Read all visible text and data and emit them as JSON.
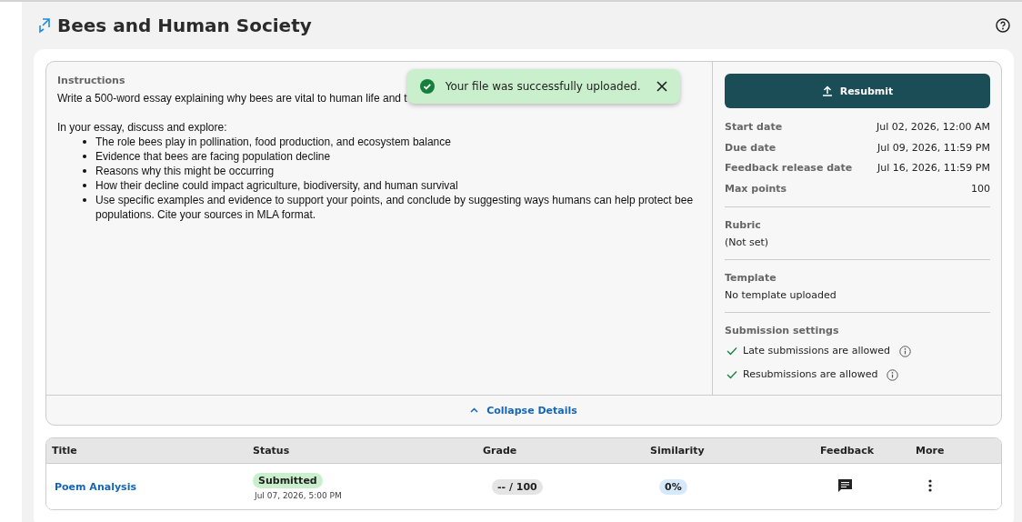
{
  "page": {
    "title": "Bees and Human Society"
  },
  "toast": {
    "message": "Your file was successfully uploaded."
  },
  "instructions": {
    "label": "Instructions",
    "intro": "Write a 500-word essay explaining why bees are vital to human life and t",
    "lead": "In your essay, discuss and explore:",
    "bullets": [
      "The role bees play in pollination, food production, and ecosystem balance",
      "Evidence that bees are facing population decline",
      "Reasons why this might be occurring",
      "How their decline could impact agriculture, biodiversity, and human survival",
      "Use specific examples and evidence to support your points, and conclude by suggesting ways humans can help protect bee populations. Cite your sources in MLA format."
    ]
  },
  "details": {
    "button": "Resubmit",
    "dates": [
      {
        "label": "Start date",
        "value": "Jul 02, 2026, 12:00 AM"
      },
      {
        "label": "Due date",
        "value": "Jul 09, 2026, 11:59 PM"
      },
      {
        "label": "Feedback release date",
        "value": "Jul 16, 2026, 11:59 PM"
      },
      {
        "label": "Max points",
        "value": "100"
      }
    ],
    "rubric": {
      "label": "Rubric",
      "value": "(Not set)"
    },
    "template": {
      "label": "Template",
      "value": "No template uploaded"
    },
    "settings": {
      "label": "Submission settings",
      "items": [
        {
          "label": "Late submissions are allowed",
          "checked": true
        },
        {
          "label": "Resubmissions are allowed",
          "checked": true
        }
      ]
    }
  },
  "collapse": "Collapse Details",
  "table": {
    "columns": [
      "Title",
      "Status",
      "Grade",
      "Similarity",
      "Feedback",
      "More"
    ],
    "rows": [
      {
        "title": "Poem Analysis",
        "status": "Submitted",
        "date": "Jul 07, 2026, 5:00 PM",
        "grade": "-- / 100",
        "similarity": "0%"
      }
    ]
  }
}
